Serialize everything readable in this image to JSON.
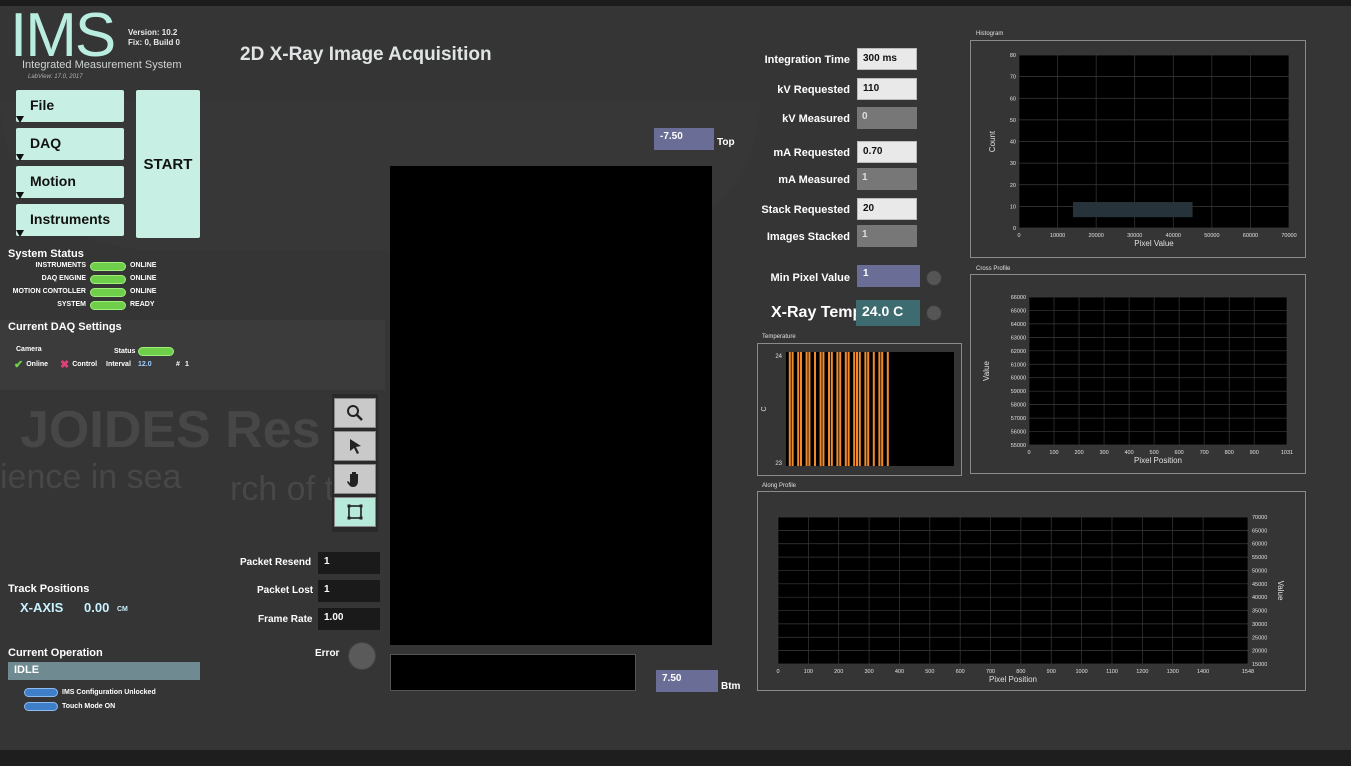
{
  "app": {
    "logo": "IMS",
    "version": "Version: 10.2",
    "fix": "Fix: 0, Build 0",
    "subtitle": "Integrated Measurement System",
    "labview": "LabView: 17.0, 2017",
    "page_title": "2D X-Ray Image Acquisition"
  },
  "menu": {
    "file": "File",
    "daq": "DAQ",
    "motion": "Motion",
    "instruments": "Instruments",
    "start": "START"
  },
  "system_status": {
    "title": "System Status",
    "rows": [
      {
        "label": "INSTRUMENTS",
        "value": "ONLINE"
      },
      {
        "label": "DAQ ENGINE",
        "value": "ONLINE"
      },
      {
        "label": "MOTION CONTOLLER",
        "value": "ONLINE"
      },
      {
        "label": "SYSTEM",
        "value": "READY"
      }
    ]
  },
  "daq_settings": {
    "title": "Current DAQ Settings",
    "camera": "Camera",
    "status": "Status",
    "online": "Online",
    "control": "Control",
    "interval_label": "Interval",
    "interval_value": "12.0",
    "count_label": "#",
    "count_value": "1"
  },
  "track": {
    "title": "Track Positions",
    "axis": "X-AXIS",
    "value": "0.00",
    "unit": "CM"
  },
  "operation": {
    "title": "Current Operation",
    "value": "IDLE",
    "config": "IMS Configuration Unlocked",
    "touch": "Touch Mode ON"
  },
  "watermark": {
    "line1": "JOIDES Res",
    "line2": "ience in sea",
    "line3": "rch of the"
  },
  "image": {
    "top_value": "-7.50",
    "top_label": "Top",
    "btm_value": "7.50",
    "btm_label": "Btm"
  },
  "tools": {
    "zoom": "zoom",
    "pointer": "pointer",
    "pan": "pan",
    "roi": "roi"
  },
  "packets": {
    "resend_label": "Packet Resend",
    "resend_value": "1",
    "lost_label": "Packet Lost",
    "lost_value": "1",
    "frame_label": "Frame Rate",
    "frame_value": "1.00",
    "error_label": "Error"
  },
  "params": {
    "integration_label": "Integration Time",
    "integration_value": "300 ms",
    "kv_req_label": "kV Requested",
    "kv_req_value": "110",
    "kv_meas_label": "kV Measured",
    "kv_meas_value": "0",
    "ma_req_label": "mA Requested",
    "ma_req_value": "0.70",
    "ma_meas_label": "mA Measured",
    "ma_meas_value": "1",
    "stack_req_label": "Stack Requested",
    "stack_req_value": "20",
    "images_stacked_label": "Images Stacked",
    "images_stacked_value": "1",
    "min_pixel_label": "Min Pixel Value",
    "min_pixel_value": "1",
    "xray_temp_label": "X-Ray Temp",
    "xray_temp_value": "24.0 C"
  },
  "colors": {
    "accent": "#c8efe3",
    "status_green": "#6fcf4a",
    "status_blue": "#3f7ec8",
    "temp_bars": "#f08a2a"
  },
  "chart_data": [
    {
      "id": "histogram",
      "type": "bar",
      "title": "Histogram",
      "xlabel": "Pixel Value",
      "ylabel": "Count",
      "xlim": [
        0,
        70000
      ],
      "ylim": [
        0,
        80
      ],
      "xticks": [
        0,
        10000,
        20000,
        30000,
        40000,
        50000,
        60000,
        70000
      ],
      "yticks": [
        0,
        10,
        20,
        30,
        40,
        50,
        60,
        70,
        80
      ],
      "bars": [
        {
          "x0": 14000,
          "x1": 45000,
          "y0": 5,
          "y1": 12
        }
      ],
      "grid": true
    },
    {
      "id": "cross_profile",
      "type": "line",
      "title": "Cross Profile",
      "xlabel": "Pixel Position",
      "ylabel": "Value",
      "xlim": [
        0,
        1031
      ],
      "ylim": [
        55000,
        66000
      ],
      "xticks": [
        0,
        100,
        200,
        300,
        400,
        500,
        600,
        700,
        800,
        900,
        1031
      ],
      "yticks": [
        55000,
        56000,
        57000,
        58000,
        59000,
        60000,
        61000,
        62000,
        63000,
        64000,
        65000,
        66000
      ],
      "grid": true
    },
    {
      "id": "temperature",
      "type": "bar",
      "title": "Temperature",
      "ylabel": "C",
      "ylim": [
        23,
        24
      ],
      "yticks": [
        23,
        24
      ],
      "x": [
        1,
        2,
        4,
        5,
        7,
        8,
        10,
        12,
        13,
        15,
        16,
        18,
        19,
        21,
        22,
        24,
        25,
        26,
        28,
        29,
        31,
        33,
        34,
        36
      ],
      "n_slots": 60,
      "grid": false
    },
    {
      "id": "along_profile",
      "type": "line",
      "title": "Along Profile",
      "xlabel": "Pixel Position",
      "ylabel": "Value",
      "xlim": [
        0,
        1548
      ],
      "ylim": [
        15000,
        70000
      ],
      "xticks": [
        0,
        100,
        200,
        300,
        400,
        500,
        600,
        700,
        800,
        900,
        1000,
        1100,
        1200,
        1300,
        1400,
        1548
      ],
      "yticks": [
        15000,
        20000,
        25000,
        30000,
        35000,
        40000,
        45000,
        50000,
        55000,
        60000,
        65000,
        70000
      ],
      "grid": true
    }
  ]
}
